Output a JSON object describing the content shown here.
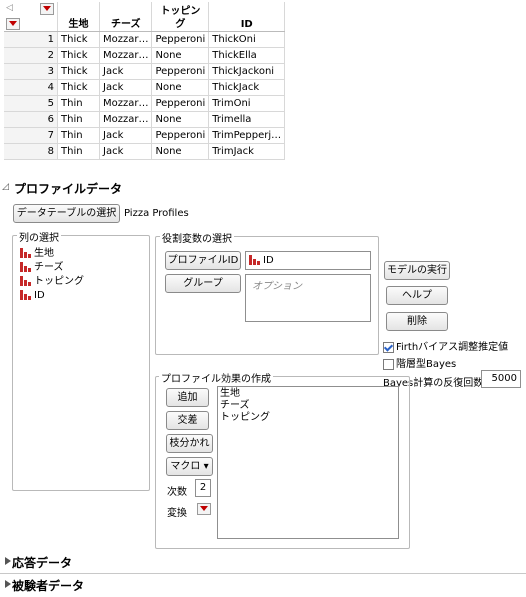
{
  "table": {
    "columns": [
      "生地",
      "チーズ",
      "トッピング",
      "ID"
    ],
    "rows": [
      {
        "n": "1",
        "dough": "Thick",
        "cheese": "Mozzar…",
        "topping": "Pepperoni",
        "id": "ThickOni"
      },
      {
        "n": "2",
        "dough": "Thick",
        "cheese": "Mozzar…",
        "topping": "None",
        "id": "ThickElla"
      },
      {
        "n": "3",
        "dough": "Thick",
        "cheese": "Jack",
        "topping": "Pepperoni",
        "id": "ThickJackoni"
      },
      {
        "n": "4",
        "dough": "Thick",
        "cheese": "Jack",
        "topping": "None",
        "id": "ThickJack"
      },
      {
        "n": "5",
        "dough": "Thin",
        "cheese": "Mozzar…",
        "topping": "Pepperoni",
        "id": "TrimOni"
      },
      {
        "n": "6",
        "dough": "Thin",
        "cheese": "Mozzar…",
        "topping": "None",
        "id": "Trimella"
      },
      {
        "n": "7",
        "dough": "Thin",
        "cheese": "Jack",
        "topping": "Pepperoni",
        "id": "TrimPepperj…"
      },
      {
        "n": "8",
        "dough": "Thin",
        "cheese": "Jack",
        "topping": "None",
        "id": "TrimJack"
      }
    ]
  },
  "profile": {
    "title": "プロファイルデータ",
    "select_table_btn": "データテーブルの選択",
    "table_name": "Pizza Profiles",
    "column_select_label": "列の選択",
    "columns": [
      "生地",
      "チーズ",
      "トッピング",
      "ID"
    ],
    "role_label": "役割変数の選択",
    "profile_id_btn": "プロファイルID",
    "profile_id_value": "ID",
    "group_btn": "グループ",
    "group_placeholder": "オプション",
    "run_btn": "モデルの実行",
    "help_btn": "ヘルプ",
    "delete_btn": "削除",
    "firth_label": "Firthバイアス調整推定値",
    "firth_checked": true,
    "hier_label": "階層型Bayes",
    "hier_checked": false,
    "bayes_iter_label": "Bayes計算の反復回数",
    "bayes_iter_value": "5000",
    "effects_label": "プロファイル効果の作成",
    "add_btn": "追加",
    "cross_btn": "交差",
    "nest_btn": "枝分かれ",
    "macro_btn": "マクロ ▾",
    "degree_label": "次数",
    "degree_value": "2",
    "transform_label": "変換",
    "effects": [
      "生地",
      "チーズ",
      "トッピング"
    ]
  },
  "sections": {
    "response": "応答データ",
    "subject": "被験者データ"
  }
}
